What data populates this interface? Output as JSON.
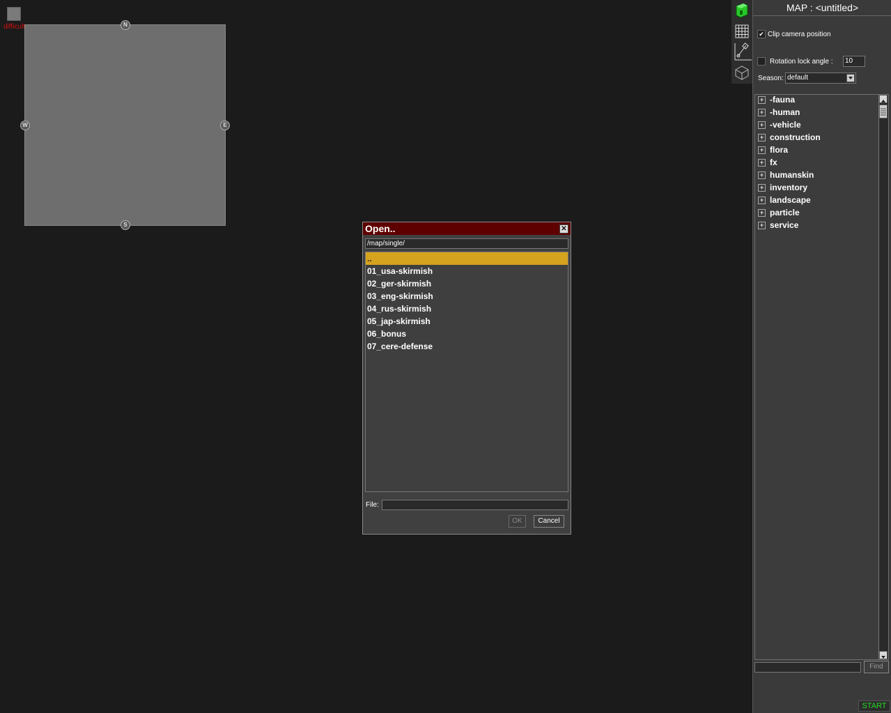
{
  "minimap": {
    "difficulty": "difficulty: none",
    "compass": {
      "n": "N",
      "s": "S",
      "w": "W",
      "e": "E"
    }
  },
  "tools": [
    "building-tool-icon",
    "grid-tool-icon",
    "measure-tool-icon",
    "box-tool-icon"
  ],
  "panel": {
    "title": "MAP : <untitled>",
    "clip_camera": {
      "label": "Clip camera position",
      "checked": true
    },
    "rotation_lock": {
      "label": "Rotation lock angle :",
      "checked": false,
      "value": "10"
    },
    "season": {
      "label": "Season:",
      "value": "default"
    },
    "tree_items": [
      "-fauna",
      "-human",
      "-vehicle",
      "construction",
      "flora",
      "fx",
      "humanskin",
      "inventory",
      "landscape",
      "particle",
      "service"
    ],
    "search_value": "",
    "find_label": "Find",
    "start_label": "START"
  },
  "dialog": {
    "title": "Open..",
    "path": "/map/single/",
    "items": [
      "..",
      "01_usa-skirmish",
      "02_ger-skirmish",
      "03_eng-skirmish",
      "04_rus-skirmish",
      "05_jap-skirmish",
      "06_bonus",
      "07_cere-defense"
    ],
    "selected_index": 0,
    "file_label": "File:",
    "file_value": "",
    "ok_label": "OK",
    "cancel_label": "Cancel"
  },
  "colors": {
    "dialog_title_bg": "#5f0000",
    "selection": "#d6a31e",
    "start_text": "#22dd22",
    "difficulty_text": "#d01010"
  }
}
